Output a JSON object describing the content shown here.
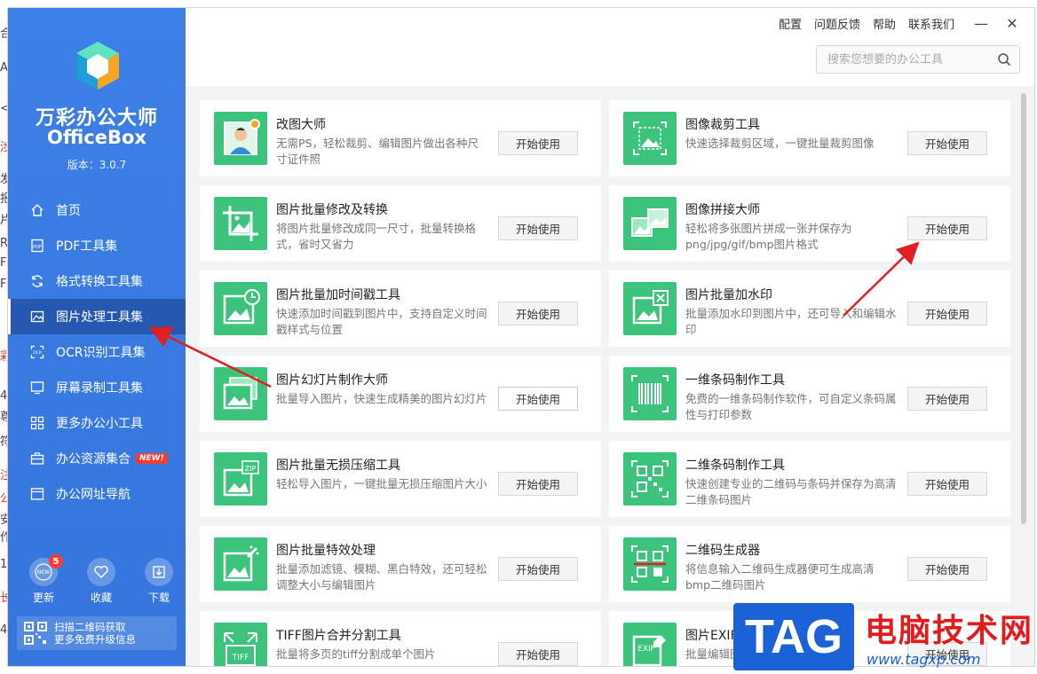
{
  "sidebar": {
    "brand_cn": "万彩办公大师",
    "brand_en": "OfficeBox",
    "version": "版本：3.0.7",
    "nav": [
      {
        "label": "首页",
        "icon": "home-icon"
      },
      {
        "label": "PDF工具集",
        "icon": "pdf-icon"
      },
      {
        "label": "格式转换工具集",
        "icon": "convert-icon"
      },
      {
        "label": "图片处理工具集",
        "icon": "image-icon",
        "active": true
      },
      {
        "label": "OCR识别工具集",
        "icon": "ocr-icon"
      },
      {
        "label": "屏幕录制工具集",
        "icon": "screen-record-icon"
      },
      {
        "label": "更多办公小工具",
        "icon": "grid-icon"
      },
      {
        "label": "办公资源集合",
        "icon": "briefcase-icon",
        "badge": "NEW!"
      },
      {
        "label": "办公网址导航",
        "icon": "browser-icon"
      }
    ],
    "bottom": {
      "update_label": "更新",
      "update_count": "5",
      "update_badge": "NEW",
      "favorite_label": "收藏",
      "download_label": "下载"
    },
    "promo": {
      "line1": "扫描二维码获取",
      "line2": "更多免费升级信息"
    }
  },
  "topbar": {
    "links": [
      "配置",
      "问题反馈",
      "帮助",
      "联系我们"
    ],
    "minimize": "—",
    "close": "✕",
    "search_placeholder": "搜索您想要的办公工具"
  },
  "tools": [
    {
      "title": "改图大师",
      "desc": "无需PS，轻松裁剪、编辑图片做出各种尺寸证件照",
      "button": "开始使用"
    },
    {
      "title": "图像裁剪工具",
      "desc": "快速选择裁剪区域，一键批量裁剪图像",
      "button": "开始使用"
    },
    {
      "title": "图片批量修改及转换",
      "desc": "将图片批量修改成同一尺寸，批量转换格式，省时又省力",
      "button": "开始使用"
    },
    {
      "title": "图像拼接大师",
      "desc": "轻松将多张图片拼成一张并保存为png/jpg/gif/bmp图片格式",
      "button": "开始使用"
    },
    {
      "title": "图片批量加时间戳工具",
      "desc": "快速添加时间戳到图片中，支持自定义时间戳样式与位置",
      "button": "开始使用"
    },
    {
      "title": "图片批量加水印",
      "desc": "批量添加水印到图片中，还可导入和编辑水印",
      "button": "开始使用"
    },
    {
      "title": "图片幻灯片制作大师",
      "desc": "批量导入图片，快速生成精美的图片幻灯片",
      "button": "开始使用"
    },
    {
      "title": "一维条码制作工具",
      "desc": "免费的一维条码制作软件，可自定义条码属性与打印参数",
      "button": "开始使用"
    },
    {
      "title": "图片批量无损压缩工具",
      "desc": "轻松导入图片，一键批量无损压缩图片大小",
      "button": "开始使用"
    },
    {
      "title": "二维条码制作工具",
      "desc": "快速创建专业的二维码与条码并保存为高清二维条码图片",
      "button": "开始使用"
    },
    {
      "title": "图片批量特效处理",
      "desc": "批量添加滤镜、模糊、黑白特效，还可轻松调整大小与编辑图片",
      "button": "开始使用"
    },
    {
      "title": "二维码生成器",
      "desc": "将信息输入二维码生成器便可生成高清bmp二维码图片",
      "button": "开始使用"
    },
    {
      "title": "TIFF图片合并分割工具",
      "desc": "批量将多页的tiff分割成单个图片",
      "button": "开始使用"
    },
    {
      "title": "图片EXIF",
      "desc": "批量编辑图片",
      "button": "开始使用"
    }
  ],
  "watermark": {
    "tag": "TAG",
    "cn": "电脑技术网",
    "url": "www.tagxp.com"
  },
  "colors": {
    "sidebar": "#3a7be1",
    "active_nav": "#2559b0",
    "tile_green": "#3cc47c",
    "arrow": "#e02020"
  }
}
